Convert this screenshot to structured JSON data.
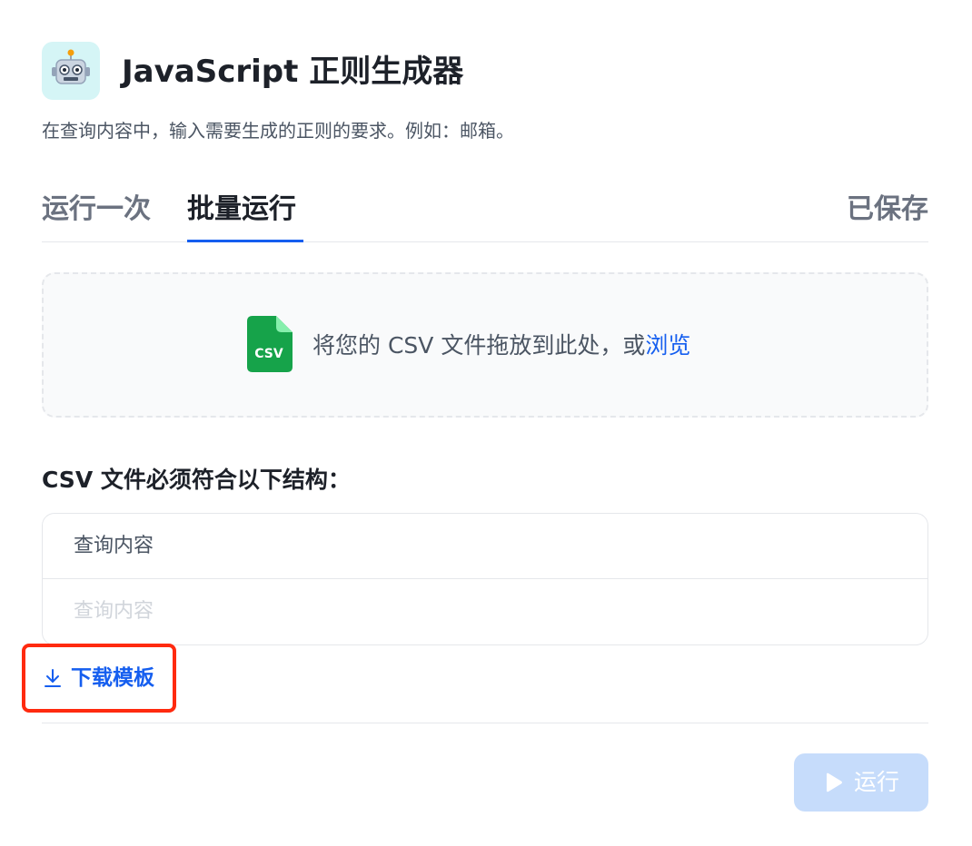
{
  "header": {
    "icon": "robot-emoji",
    "title": "JavaScript 正则生成器",
    "description": "在查询内容中，输入需要生成的正则的要求。例如：邮箱。"
  },
  "tabs": [
    {
      "label": "运行一次",
      "active": false
    },
    {
      "label": "批量运行",
      "active": true
    }
  ],
  "saved_label": "已保存",
  "upload": {
    "icon": "csv-file-icon",
    "text": "将您的 CSV 文件拖放到此处，或",
    "browse_label": "浏览"
  },
  "structure": {
    "title": "CSV 文件必须符合以下结构：",
    "column_header": "查询内容",
    "placeholder_row": "查询内容"
  },
  "download_template_label": "下载模板",
  "run_button_label": "运行",
  "colors": {
    "accent": "#155eef",
    "highlight_border": "#ff2a0f",
    "run_button_disabled": "#c6dcfb",
    "csv_icon_green": "#16a34a"
  }
}
